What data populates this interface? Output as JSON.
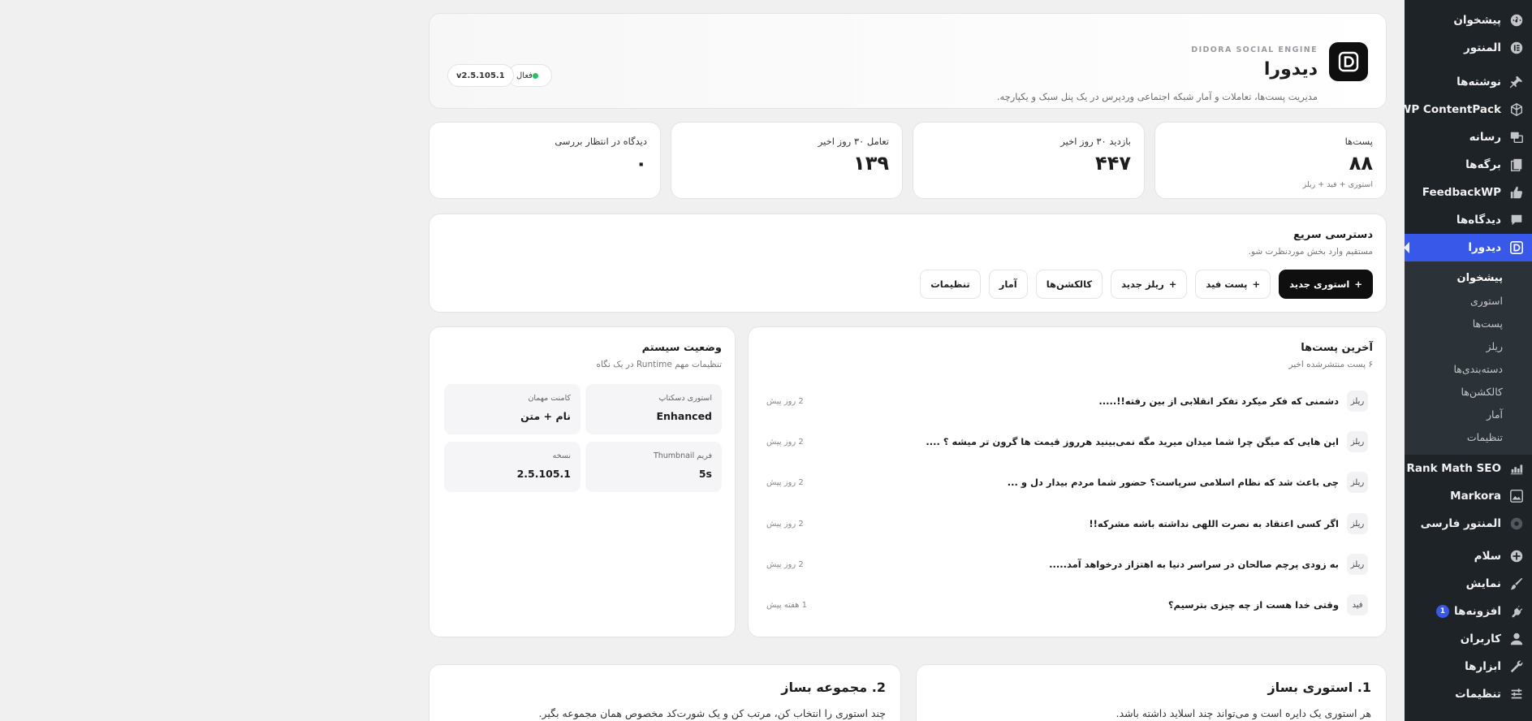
{
  "sidebar": {
    "items_top": [
      {
        "label": "پیشخوان",
        "icon": "dashboard-icon"
      },
      {
        "label": "المنتور",
        "icon": "elementor-icon"
      },
      {
        "label": "نوشته‌ها",
        "icon": "pin-icon"
      },
      {
        "label": "WP ContentPack",
        "icon": "box-icon"
      },
      {
        "label": "رسانه",
        "icon": "media-icon"
      },
      {
        "label": "برگه‌ها",
        "icon": "pages-icon"
      },
      {
        "label": "FeedbackWP",
        "icon": "thumbs-up-icon"
      },
      {
        "label": "دیدگاه‌ها",
        "icon": "comment-icon"
      }
    ],
    "active": {
      "label": "دیدورا",
      "icon": "didora-icon"
    },
    "submenu": [
      "پیشخوان",
      "استوری",
      "پست‌ها",
      "ریلز",
      "دسته‌بندی‌ها",
      "کالکشن‌ها",
      "آمار",
      "تنظیمات"
    ],
    "items_bottom": [
      {
        "label": "Rank Math SEO",
        "icon": "chart-icon"
      },
      {
        "label": "Markora",
        "icon": "image-icon"
      },
      {
        "label": "المنتور فارسی",
        "icon": "globe-icon"
      },
      {
        "label": "سلام",
        "icon": "plus-circle-icon"
      },
      {
        "label": "نمایش",
        "icon": "brush-icon"
      },
      {
        "label": "افزونه‌ها",
        "icon": "plugin-icon",
        "badge": "1"
      },
      {
        "label": "کاربران",
        "icon": "user-icon"
      },
      {
        "label": "ابزارها",
        "icon": "wrench-icon"
      },
      {
        "label": "تنظیمات",
        "icon": "settings-icon"
      }
    ]
  },
  "header": {
    "kicker": "DIDORA SOCIAL ENGINE",
    "title": "دیدورا",
    "description": "مدیریت پست‌ها، تعاملات و آمار شبکه اجتماعی وردپرس در یک پنل سبک و یکپارچه.",
    "status": "فعال",
    "version": "v2.5.105.1",
    "status_color": "#22c55e"
  },
  "stats": [
    {
      "label": "پست‌ها",
      "value": "۸۸",
      "sub": "استوری + فید + ریلز"
    },
    {
      "label": "بازدید ۳۰ روز اخیر",
      "value": "۴۴۷",
      "sub": ""
    },
    {
      "label": "تعامل ۳۰ روز اخیر",
      "value": "۱۳۹",
      "sub": ""
    },
    {
      "label": "دیدگاه در انتظار بررسی",
      "value": "۰",
      "sub": ""
    }
  ],
  "quick": {
    "title": "دسترسی سریع",
    "subtitle": "مستقیم وارد بخش موردنظرت شو.",
    "buttons": [
      {
        "label": "استوری جدید",
        "plus": "+"
      },
      {
        "label": "پست فید",
        "plus": "+"
      },
      {
        "label": "ریلز جدید",
        "plus": "+"
      },
      {
        "label": "کالکشن‌ها",
        "plus": ""
      },
      {
        "label": "آمار",
        "plus": ""
      },
      {
        "label": "تنظیمات",
        "plus": ""
      }
    ]
  },
  "posts": {
    "title": "آخرین پست‌ها",
    "subtitle": "۶ پست منتشرشده اخیر",
    "items": [
      {
        "tag": "ریلز",
        "title": "دشمنی که فکر میکرد تفکر انقلابی از بین رفته!!.....",
        "time": "2 روز پیش"
      },
      {
        "tag": "ریلز",
        "title": "این هایی که میگن چرا شما میدان میرید مگه نمی‌بینید هرروز قیمت ها گرون تر میشه ؟ ....",
        "time": "2 روز پیش"
      },
      {
        "tag": "ریلز",
        "title": "چی باعث شد که نظام اسلامی سرپاست؟ حضور شما مردم بیدار دل و ...",
        "time": "2 روز پیش"
      },
      {
        "tag": "ریلز",
        "title": "اگر کسی اعتقاد به نصرت اللهی نداشته باشه مشرکه!!",
        "time": "2 روز پیش"
      },
      {
        "tag": "ریلز",
        "title": "به زودی پرچم صالحان در سراسر دنیا به اهتزاز درخواهد آمد.....",
        "time": "2 روز پیش"
      },
      {
        "tag": "فید",
        "title": "وقتی خدا هست از چه چیزی بترسیم؟",
        "time": "1 هفته پیش"
      }
    ]
  },
  "system": {
    "title": "وضعیت سیستم",
    "subtitle": "تنظیمات مهم Runtime در یک نگاه",
    "tiles": [
      {
        "label": "استوری دسکتاپ",
        "value": "Enhanced"
      },
      {
        "label": "کامنت مهمان",
        "value": "نام + متن"
      },
      {
        "label": "فریم Thumbnail",
        "value": "5s"
      },
      {
        "label": "نسخه",
        "value": "2.5.105.1"
      }
    ]
  },
  "guides": [
    {
      "title": "1. استوری بساز",
      "desc": "هر استوری یک دایره است و می‌تواند چند اسلاید داشته باشد."
    },
    {
      "title": "2. مجموعه بساز",
      "desc": "چند استوری را انتخاب کن، مرتب کن و یک شورت‌کد مخصوص همان مجموعه بگیر."
    }
  ]
}
